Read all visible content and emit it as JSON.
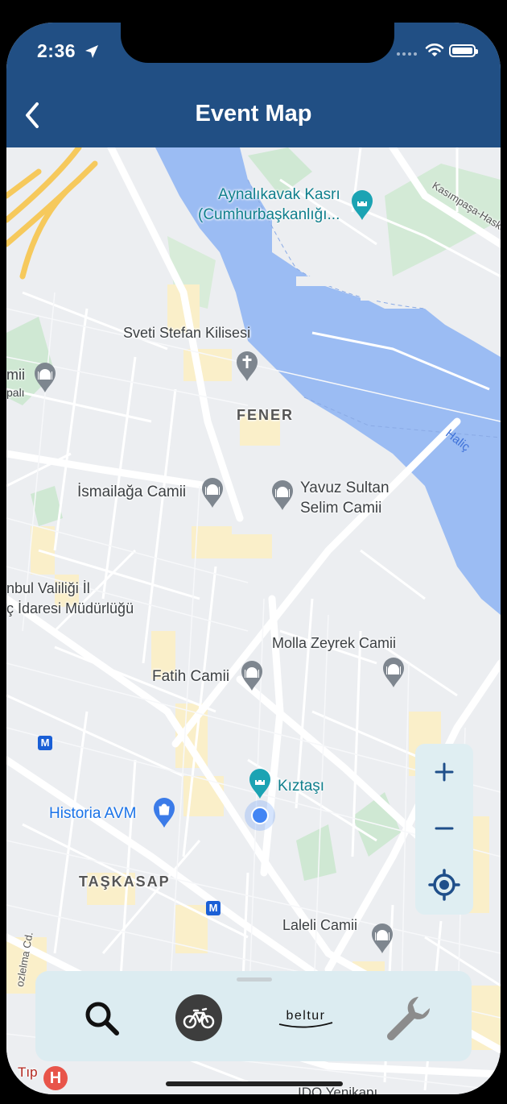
{
  "status_bar": {
    "time": "2:36"
  },
  "header": {
    "title": "Event Map"
  },
  "map": {
    "labels": {
      "aynalikavak_1": "Aynalıkavak Kasrı",
      "aynalikavak_2": "(Cumhurbaşkanlığı...",
      "kasimpasa": "Kasımpaşa-Hasköy",
      "sveti_stefan": "Sveti Stefan Kilisesi",
      "left_camii_1": "mii",
      "left_camii_2": "palı",
      "fener": "FENER",
      "halic": "Haliç",
      "ismailaga": "İsmailağa Camii",
      "yavuz_1": "Yavuz Sultan",
      "yavuz_2": "Selim Camii",
      "valilik_1": "nbul Valiliği İl",
      "valilik_2": "ç İdaresi Müdürlüğü",
      "molla": "Molla Zeyrek Camii",
      "fatih": "Fatih Camii",
      "kiztasi": "Kıztaşı",
      "historia": "Historia AVM",
      "taskasap": "TAŞKASAP",
      "laleli": "Laleli Camii",
      "tip": "Tıp",
      "ido": "İDO Yenikapı",
      "road_left": "ozlelma Cd."
    },
    "metro_label": "M",
    "hospital_label": "H"
  },
  "zoom_controls": {
    "zoom_in": "+",
    "zoom_out": "−"
  },
  "dock": {
    "items": [
      "search-icon",
      "bike-icon",
      "beltur-logo",
      "wrench-icon"
    ],
    "beltur_text": "beltur"
  },
  "colors": {
    "header": "#214f84",
    "water": "#9bbcf3",
    "dock": "#dcecf1",
    "pin_gray": "#7e868f",
    "pin_teal": "#1ba3b3"
  }
}
